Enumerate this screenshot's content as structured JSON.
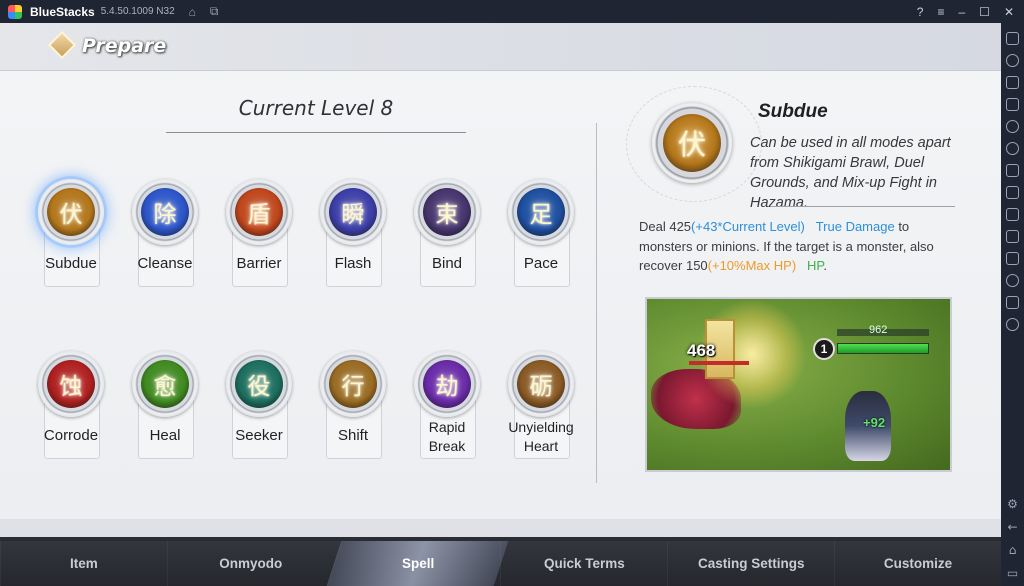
{
  "window": {
    "app_name": "BlueStacks",
    "version": "5.4.50.1009 N32"
  },
  "header": {
    "title": "Prepare"
  },
  "level": {
    "title": "Current Level 8"
  },
  "spells": [
    {
      "name": "Subdue",
      "glyph": "伏",
      "color": "#b3761a",
      "selected": true
    },
    {
      "name": "Cleanse",
      "glyph": "除",
      "color": "#2c55c9"
    },
    {
      "name": "Barrier",
      "glyph": "盾",
      "color": "#c0461b"
    },
    {
      "name": "Flash",
      "glyph": "瞬",
      "color": "#3c3ea8"
    },
    {
      "name": "Bind",
      "glyph": "束",
      "color": "#46346e"
    },
    {
      "name": "Pace",
      "glyph": "足",
      "color": "#1d4fa0"
    },
    {
      "name": "Corrode",
      "glyph": "蚀",
      "color": "#b01f1f"
    },
    {
      "name": "Heal",
      "glyph": "愈",
      "color": "#3f8a1f"
    },
    {
      "name": "Seeker",
      "glyph": "役",
      "color": "#1c6e5e"
    },
    {
      "name": "Shift",
      "glyph": "行",
      "color": "#9a6b22"
    },
    {
      "name": "Rapid\nBreak",
      "glyph": "劫",
      "color": "#6a2aa8"
    },
    {
      "name": "Unyielding\nHeart",
      "glyph": "砺",
      "color": "#8a5a24"
    }
  ],
  "detail": {
    "name": "Subdue",
    "glyph": "伏",
    "availability": "Can be used in all modes apart from Shikigami Brawl, Duel Grounds, and Mix-up Fight in Hazama.",
    "desc_1": "Deal 425",
    "desc_2": "(+43*Current Level)",
    "desc_3": "True Damage",
    "desc_4": " to monsters or minions. If the target is a monster, also recover 150",
    "desc_5": "(+10%Max HP)",
    "desc_6": "HP",
    "desc_7": "."
  },
  "preview": {
    "damage": "468",
    "level_badge": "1",
    "hp_value": "962",
    "heal_value": "+92"
  },
  "tabs": [
    {
      "label": "Item"
    },
    {
      "label": "Onmyodo"
    },
    {
      "label": "Spell",
      "active": true
    },
    {
      "label": "Quick Terms"
    },
    {
      "label": "Casting Settings"
    },
    {
      "label": "Customize"
    }
  ]
}
